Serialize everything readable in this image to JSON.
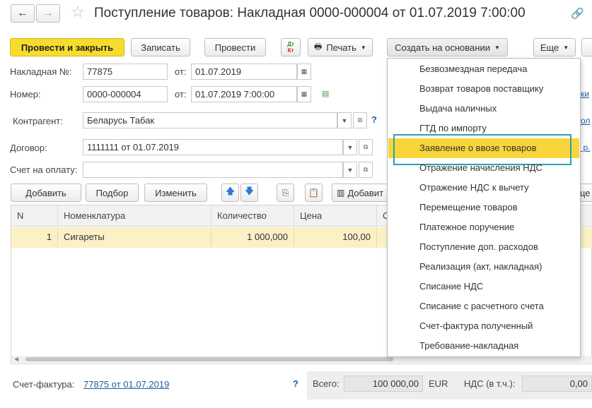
{
  "window": {
    "title": "Поступление товаров: Накладная 0000-000004 от 01.07.2019 7:00:00",
    "back_glyph": "←",
    "forward_glyph": "→"
  },
  "toolbar": {
    "post_close": "Провести и закрыть",
    "save": "Записать",
    "post": "Провести",
    "dtkt_top": "Дт",
    "dtkt_bottom": "Кт",
    "print": "Печать",
    "create_basis": "Создать на основании",
    "more": "Еще"
  },
  "form": {
    "invoice_no_label": "Накладная №:",
    "invoice_no_value": "77875",
    "from_label": "от:",
    "invoice_date": "01.07.2019",
    "number_label": "Номер:",
    "number_value": "0000-000004",
    "from_label2": "от:",
    "number_datetime": "01.07.2019  7:00:00",
    "counterparty_label": "Контрагент:",
    "counterparty_value": "Беларусь Табак",
    "contract_label": "Договор:",
    "contract_value": "1111111 от 01.07.2019",
    "payment_account_label": "Счет на оплату:",
    "payment_account_value": "",
    "help": "?"
  },
  "table_toolbar": {
    "add": "Добавить",
    "pick": "Подбор",
    "edit": "Изменить",
    "add_barcode": "Добавит"
  },
  "table": {
    "columns": [
      "N",
      "Номенклатура",
      "Количество",
      "Цена",
      "С"
    ],
    "rows": [
      {
        "n": "1",
        "item": "Сигареты",
        "qty": "1 000,000",
        "price": "100,00"
      }
    ]
  },
  "dropdown": {
    "items": [
      "Безвозмездная передача",
      "Возврат товаров поставщику",
      "Выдача наличных",
      "ГТД по импорту",
      "Заявление о ввозе товаров",
      "Отражение начисления НДС",
      "Отражение НДС к вычету",
      "Перемещение товаров",
      "Платежное поручение",
      "Поступление доп. расходов",
      "Реализация (акт, накладная)",
      "Списание НДС",
      "Списание с расчетного счета",
      "Счет-фактура полученный",
      "Требование-накладная"
    ],
    "highlighted_index": 4,
    "highlight_color": "#f8d53a",
    "outline_color": "#2aa0b3"
  },
  "right_edge": {
    "link1": "ки",
    "link2": "ол",
    "link3": "Ф р."
  },
  "footer": {
    "invoice_label": "Счет-фактура:",
    "invoice_link": "77875 от 01.07.2019",
    "help": "?",
    "total_label": "Всего:",
    "total_value": "100 000,00",
    "currency": "EUR",
    "vat_label": "НДС (в т.ч.):",
    "vat_value": "0,00"
  },
  "colors": {
    "primary_button": "#f7dc30",
    "selected_row": "#fbf0c6",
    "link": "#1f5c9c"
  }
}
